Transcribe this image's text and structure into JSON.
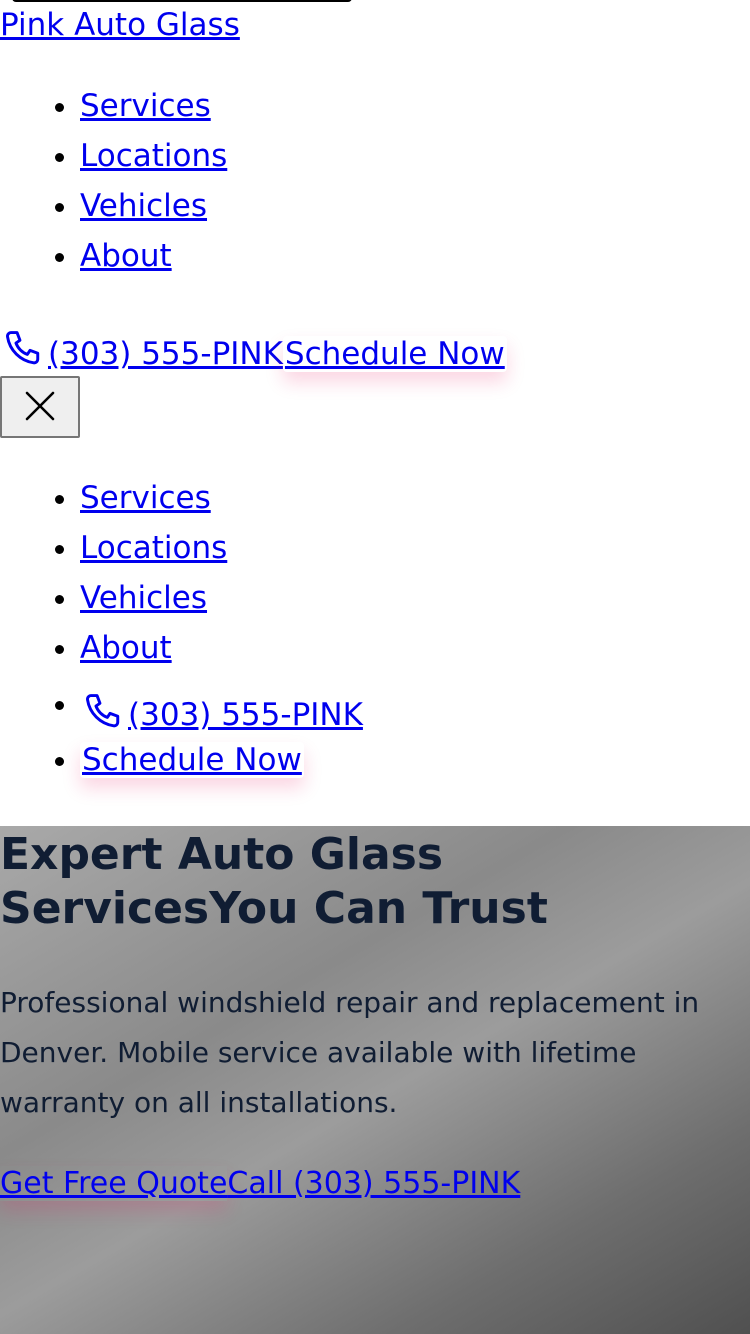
{
  "header": {
    "brand": "Pink Auto Glass",
    "nav": [
      {
        "label": "Services"
      },
      {
        "label": "Locations"
      },
      {
        "label": "Vehicles"
      },
      {
        "label": "About"
      }
    ],
    "phone": "(303) 555-PINK",
    "schedule": "Schedule Now",
    "phone_icon": "phone-icon",
    "close_icon": "close-icon"
  },
  "mobile_menu": {
    "items": [
      {
        "label": "Services"
      },
      {
        "label": "Locations"
      },
      {
        "label": "Vehicles"
      },
      {
        "label": "About"
      }
    ],
    "phone": "(303) 555-PINK",
    "schedule": "Schedule Now"
  },
  "hero": {
    "title": "Expert Auto Glass ServicesYou Can Trust",
    "subtitle": "Professional windshield repair and replacement in Denver. Mobile service available with lifetime warranty on all installations.",
    "cta_quote": "Get Free Quote",
    "cta_call": "Call (303) 555-PINK"
  },
  "colors": {
    "link": "#0000ee",
    "hero_text": "#101d33",
    "accent_glow": "#e91e63"
  }
}
